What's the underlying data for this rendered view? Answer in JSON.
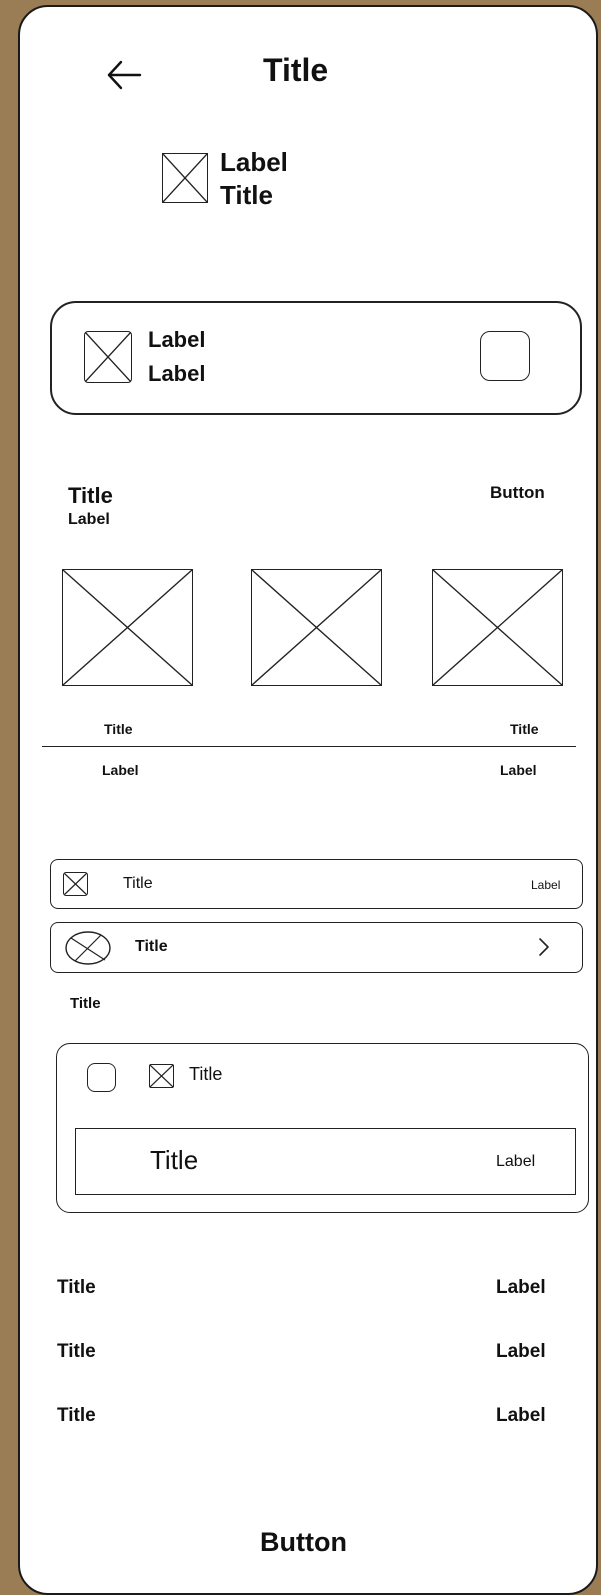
{
  "header": {
    "back_icon": "arrow-left-icon",
    "title": "Title"
  },
  "profile": {
    "label": "Label",
    "title": "Title"
  },
  "card": {
    "line1": "Label",
    "line2": "Label"
  },
  "section": {
    "title": "Title",
    "label": "Label",
    "action_label": "Button",
    "tiles": [
      {
        "title": "Title",
        "label": "Label"
      },
      {
        "title": "Title",
        "label": "Label"
      }
    ]
  },
  "list": {
    "row1": {
      "title": "Title",
      "label": "Label"
    },
    "row2": {
      "title": "Title",
      "chevron_icon": "chevron-right-icon"
    },
    "caption": "Title"
  },
  "group": {
    "item_title": "Title",
    "inner_title": "Title",
    "inner_label": "Label"
  },
  "details": [
    {
      "title": "Title",
      "label": "Label"
    },
    {
      "title": "Title",
      "label": "Label"
    },
    {
      "title": "Title",
      "label": "Label"
    }
  ],
  "footer": {
    "button_label": "Button"
  }
}
